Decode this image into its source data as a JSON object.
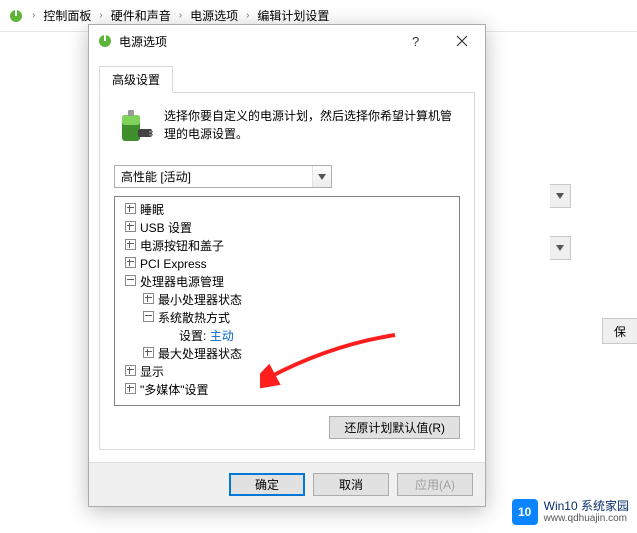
{
  "breadcrumb": {
    "items": [
      "控制面板",
      "硬件和声音",
      "电源选项",
      "编辑计划设置"
    ]
  },
  "dialog": {
    "title": "电源选项",
    "tab": "高级设置",
    "intro": "选择你要自定义的电源计划，然后选择你希望计算机管理的电源设置。",
    "plan_combo": "高性能 [活动]",
    "tree": {
      "sleep": "睡眠",
      "usb": "USB 设置",
      "power_button": "电源按钮和盖子",
      "pci": "PCI Express",
      "cpu_pm": "处理器电源管理",
      "min_state": "最小处理器状态",
      "cooling": "系统散热方式",
      "setting_label": "设置:",
      "setting_value": "主动",
      "max_state": "最大处理器状态",
      "display": "显示",
      "multimedia": "\"多媒体\"设置"
    },
    "restore": "还原计划默认值(R)",
    "ok": "确定",
    "cancel": "取消",
    "apply": "应用(A)"
  },
  "bg": {
    "save": "保"
  },
  "watermark": {
    "logo": "10",
    "title": "Win10 系统家园",
    "url": "www.qdhuajin.com"
  }
}
